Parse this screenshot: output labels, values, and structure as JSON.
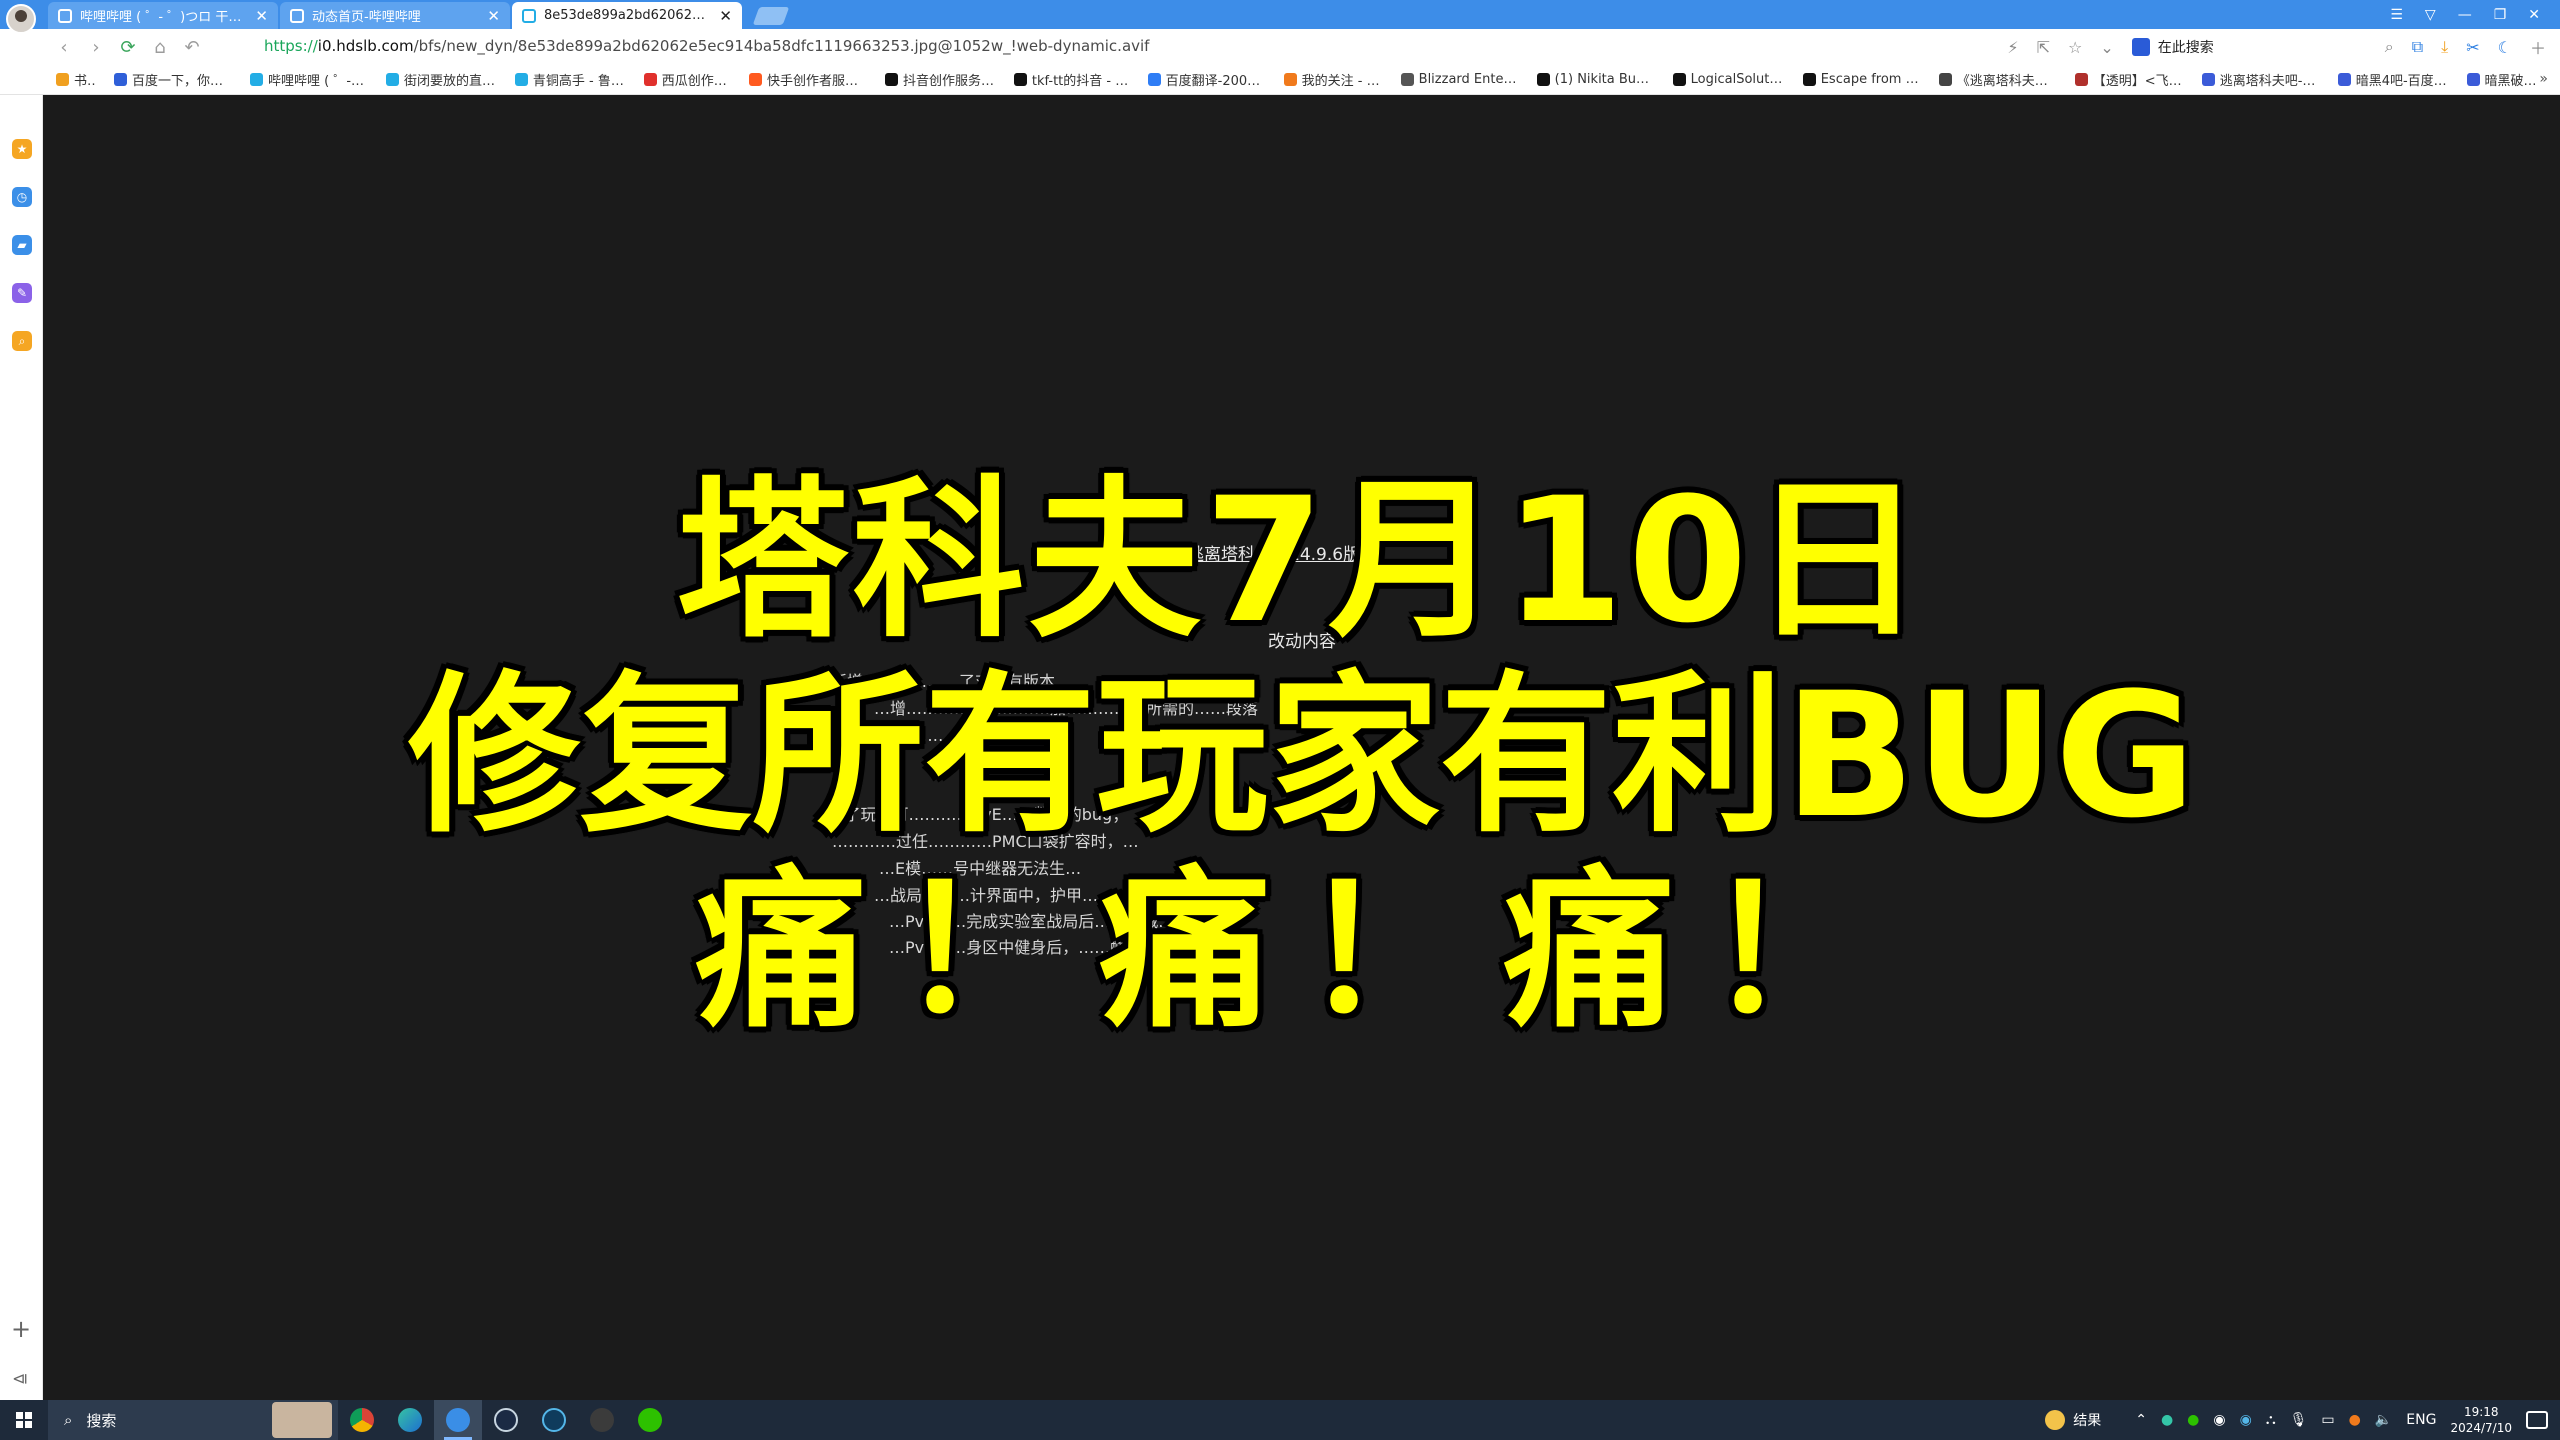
{
  "tabs": [
    {
      "title": "哔哩哔哩 ( ゜- ゜)つロ 干杯~-bilibili",
      "active": false
    },
    {
      "title": "动态首页-哔哩哔哩",
      "active": false
    },
    {
      "title": "8e53de899a2bd62062e5ec914ba58dfc1119663253.jpg",
      "active": true
    }
  ],
  "address": {
    "protocol": "https://",
    "host": "i0.hdslb.com",
    "path": "/bfs/new_dyn/8e53de899a2bd62062e5ec914ba58dfc1119663253.jpg@1052w_!web-dynamic.avif"
  },
  "search_box": {
    "placeholder": "在此搜索"
  },
  "bookmarks": [
    {
      "label": "书签",
      "color": "#f0a020"
    },
    {
      "label": "百度一下，你就知道",
      "color": "#2f5fd8"
    },
    {
      "label": "哔哩哔哩 ( ゜- ゜)つ",
      "color": "#23ade5"
    },
    {
      "label": "街闭要放的直播间",
      "color": "#23ade5"
    },
    {
      "label": "青铜高手 - 鲁蒋汉",
      "color": "#23ade5"
    },
    {
      "label": "西瓜创作平台",
      "color": "#e0302c"
    },
    {
      "label": "快手创作者服务平台",
      "color": "#ff5a1f"
    },
    {
      "label": "抖音创作服务平台",
      "color": "#111111"
    },
    {
      "label": "tkf-tt的抖音 - 抖音",
      "color": "#111111"
    },
    {
      "label": "百度翻译-200种语言",
      "color": "#2f7df5"
    },
    {
      "label": "我的关注 - 斗鱼",
      "color": "#f07a1c"
    },
    {
      "label": "Blizzard Entertainment",
      "color": "#555555"
    },
    {
      "label": "(1) Nikita Buyanov",
      "color": "#111111"
    },
    {
      "label": "LogicalSolutions",
      "color": "#111111"
    },
    {
      "label": "Escape from Tarkov",
      "color": "#111111"
    },
    {
      "label": "《逃离塔科夫》官网",
      "color": "#444444"
    },
    {
      "label": "【透明】<飞天大",
      "color": "#b0302c"
    },
    {
      "label": "逃离塔科夫吧-百度贴吧",
      "color": "#3b5bd8"
    },
    {
      "label": "暗黑4吧-百度贴吧",
      "color": "#3b5bd8"
    },
    {
      "label": "暗黑破坏神",
      "color": "#3b5bd8"
    }
  ],
  "sidebar": {
    "icons": [
      {
        "name": "star-icon",
        "color": "#f5a623"
      },
      {
        "name": "history-icon",
        "color": "#3b8fe8"
      },
      {
        "name": "game-icon",
        "color": "#3b8fe8"
      },
      {
        "name": "note-icon",
        "color": "#8b62e8"
      },
      {
        "name": "search-icon",
        "color": "#f5a623"
      }
    ]
  },
  "image": {
    "notice_title": "《逃离塔科夫》14.9.6版本",
    "notice_subtitle": "改动内容",
    "notice_lines": [
      "新增一条…………了对所有版本…",
      "…增…………物…………加……………所需的……段落",
      "…了………………团的……",
      "• …了玩家可…………PvE……数量的bug；",
      "…………过任…………PMC口袋扩容时，…",
      "…E模……号中继器无法生…",
      "…战局后……计界面中，护甲……",
      "…PvE……完成实验室战局后……扣减…；",
      "…PvE……身区中健身后，……酸痛……异常的问题。"
    ],
    "headline_line1": "塔科夫7月10日",
    "headline_line2": "修复所有玩家有利BUG",
    "headline_line3": "痛！痛！痛！",
    "headline_color": "#ffff00"
  },
  "taskbar": {
    "search_label": "搜索",
    "apps": [
      "chrome-icon",
      "edge-icon",
      "sogou-browser-icon",
      "steam-icon",
      "bsg-launcher-icon",
      "obs-icon",
      "wechat-icon"
    ],
    "weather": "结果",
    "language": "ENG",
    "time": "19:18",
    "date": "2024/7/10"
  }
}
